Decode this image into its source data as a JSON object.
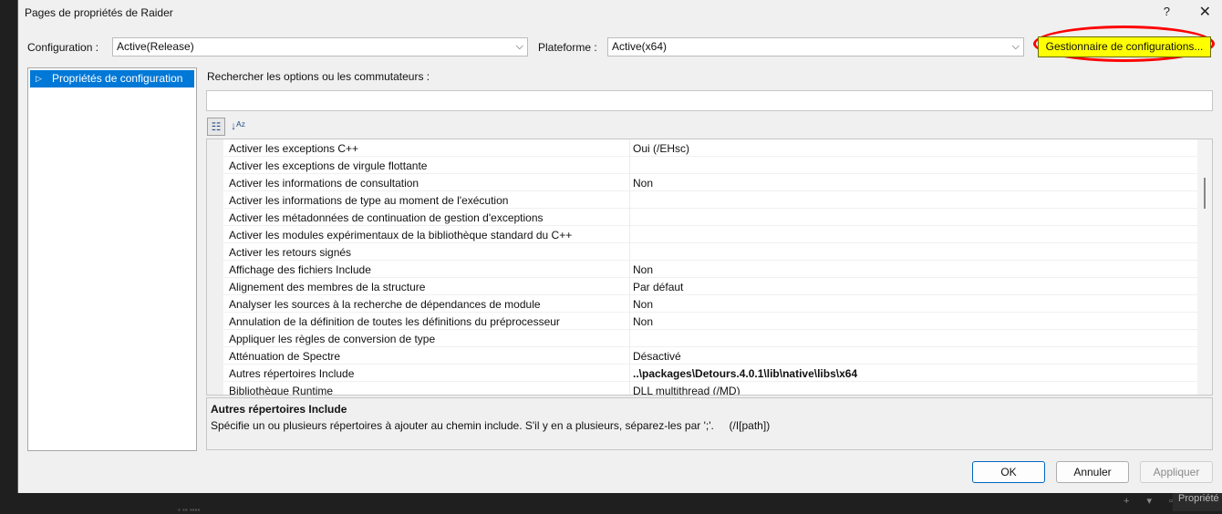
{
  "window": {
    "title": "Pages de propriétés de Raider",
    "help_glyph": "?",
    "close_glyph": "✕"
  },
  "toolbar": {
    "configuration_label": "Configuration :",
    "configuration_value": "Active(Release)",
    "platform_label": "Plateforme :",
    "platform_value": "Active(x64)",
    "config_manager_label": "Gestionnaire de configurations...",
    "config_manager_highlight": "#ffff00",
    "annotation_color": "#ff0000"
  },
  "tree": {
    "items": [
      {
        "label": "Propriétés de configuration",
        "selected": true
      }
    ]
  },
  "search": {
    "label": "Rechercher les options ou les commutateurs :",
    "value": "",
    "placeholder": ""
  },
  "grid": {
    "rows": [
      {
        "name": "Activer les exceptions C++",
        "value": "Oui (/EHsc)"
      },
      {
        "name": "Activer les exceptions de virgule flottante",
        "value": ""
      },
      {
        "name": "Activer les informations de consultation",
        "value": "Non"
      },
      {
        "name": "Activer les informations de type au moment de l'exécution",
        "value": ""
      },
      {
        "name": "Activer les métadonnées de continuation de gestion d'exceptions",
        "value": ""
      },
      {
        "name": "Activer les modules expérimentaux de la bibliothèque standard du C++",
        "value": ""
      },
      {
        "name": "Activer les retours signés",
        "value": ""
      },
      {
        "name": "Affichage des fichiers Include",
        "value": "Non"
      },
      {
        "name": "Alignement des membres de la structure",
        "value": "Par défaut"
      },
      {
        "name": "Analyser les sources à la recherche de dépendances de module",
        "value": "Non"
      },
      {
        "name": "Annulation de la définition de toutes les définitions du préprocesseur",
        "value": "Non"
      },
      {
        "name": "Appliquer les règles de conversion de type",
        "value": ""
      },
      {
        "name": "Atténuation de Spectre",
        "value": "Désactivé"
      },
      {
        "name": "Autres répertoires Include",
        "value": "..\\packages\\Detours.4.0.1\\lib\\native\\libs\\x64",
        "selected": true
      },
      {
        "name": "Bibliothèque Runtime",
        "value": "DLL multithread (/MD)"
      }
    ]
  },
  "description": {
    "title": "Autres répertoires Include",
    "text": "Spécifie un ou plusieurs répertoires à ajouter au chemin include. S'il y en a plusieurs, séparez-les par ';'.     (/I[path])"
  },
  "buttons": {
    "ok": "OK",
    "cancel": "Annuler",
    "apply": "Appliquer"
  },
  "background": {
    "right_label": "Propriété"
  }
}
